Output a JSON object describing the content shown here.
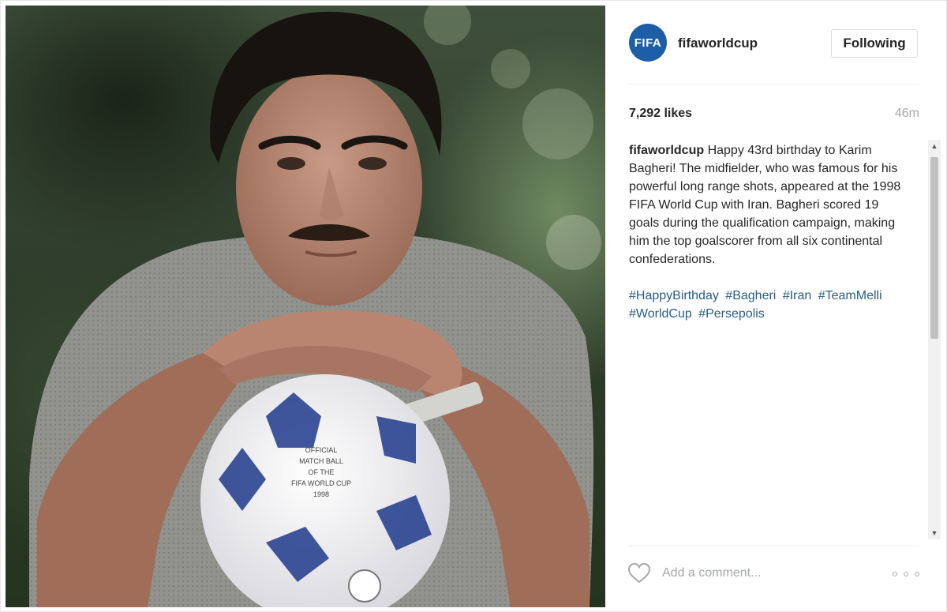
{
  "post": {
    "account": {
      "avatar_text": "FIFA",
      "username": "fifaworldcup"
    },
    "follow_button_label": "Following",
    "likes": "7,292 likes",
    "time_ago": "46m",
    "caption": {
      "author": "fifaworldcup",
      "text": "Happy 43rd birthday to Karim Bagheri! The midfielder, who was famous for his powerful long range shots, appeared at the 1998 FIFA World Cup with Iran. Bagheri scored 19 goals during the qualification campaign, making him the top goalscorer from all six continental confederations."
    },
    "hashtags": [
      "#HappyBirthday",
      "#Bagheri",
      "#Iran",
      "#TeamMelli",
      "#WorldCup",
      "#Persepolis"
    ],
    "comment_placeholder": "Add a comment...",
    "ball_text": {
      "line1": "OFFICIAL",
      "line2": "MATCH BALL",
      "line3": "OF THE",
      "line4": "FIFA WORLD CUP",
      "line5": "1998"
    }
  },
  "colors": {
    "hashtag": "#2a5c85",
    "muted": "#a5a7aa",
    "avatar_bg": "#1d5fa7"
  },
  "icons": [
    "heart-icon",
    "more-options-icon",
    "scroll-up-arrow",
    "scroll-down-arrow"
  ]
}
